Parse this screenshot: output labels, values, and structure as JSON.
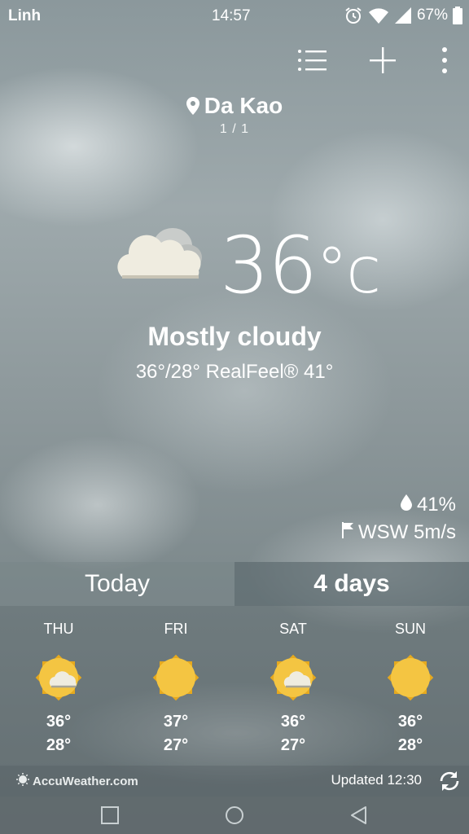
{
  "statusbar": {
    "carrier": "Linh",
    "time": "14:57",
    "battery": "67%",
    "icons": [
      "alarm-icon",
      "wifi-icon",
      "signal-icon",
      "battery-icon"
    ]
  },
  "toolbar": {
    "icons": [
      "list-icon",
      "add-icon",
      "more-icon"
    ]
  },
  "location": {
    "name": "Da Kao",
    "page": "1 / 1"
  },
  "current": {
    "icon": "mostly-cloudy-icon",
    "temperature": "36",
    "unit": "°c",
    "condition": "Mostly cloudy",
    "hilo_realfeel": "36°/28° RealFeel® 41°",
    "humidity": "41%",
    "wind": "WSW 5m/s"
  },
  "tabs": {
    "today": "Today",
    "four_days": "4 days",
    "active": "four_days"
  },
  "forecast": [
    {
      "day": "THU",
      "icon": "sun-cloud-icon",
      "high": "36°",
      "low": "28°"
    },
    {
      "day": "FRI",
      "icon": "sun-icon",
      "high": "37°",
      "low": "27°"
    },
    {
      "day": "SAT",
      "icon": "sun-cloud-icon",
      "high": "36°",
      "low": "27°"
    },
    {
      "day": "SUN",
      "icon": "sun-icon",
      "high": "36°",
      "low": "28°"
    }
  ],
  "footer": {
    "provider": "AccuWeather.com",
    "updated": "Updated 12:30"
  },
  "colors": {
    "sun": "#f4c542",
    "sun_ray": "#e6a91e",
    "cloud": "#efece0"
  }
}
